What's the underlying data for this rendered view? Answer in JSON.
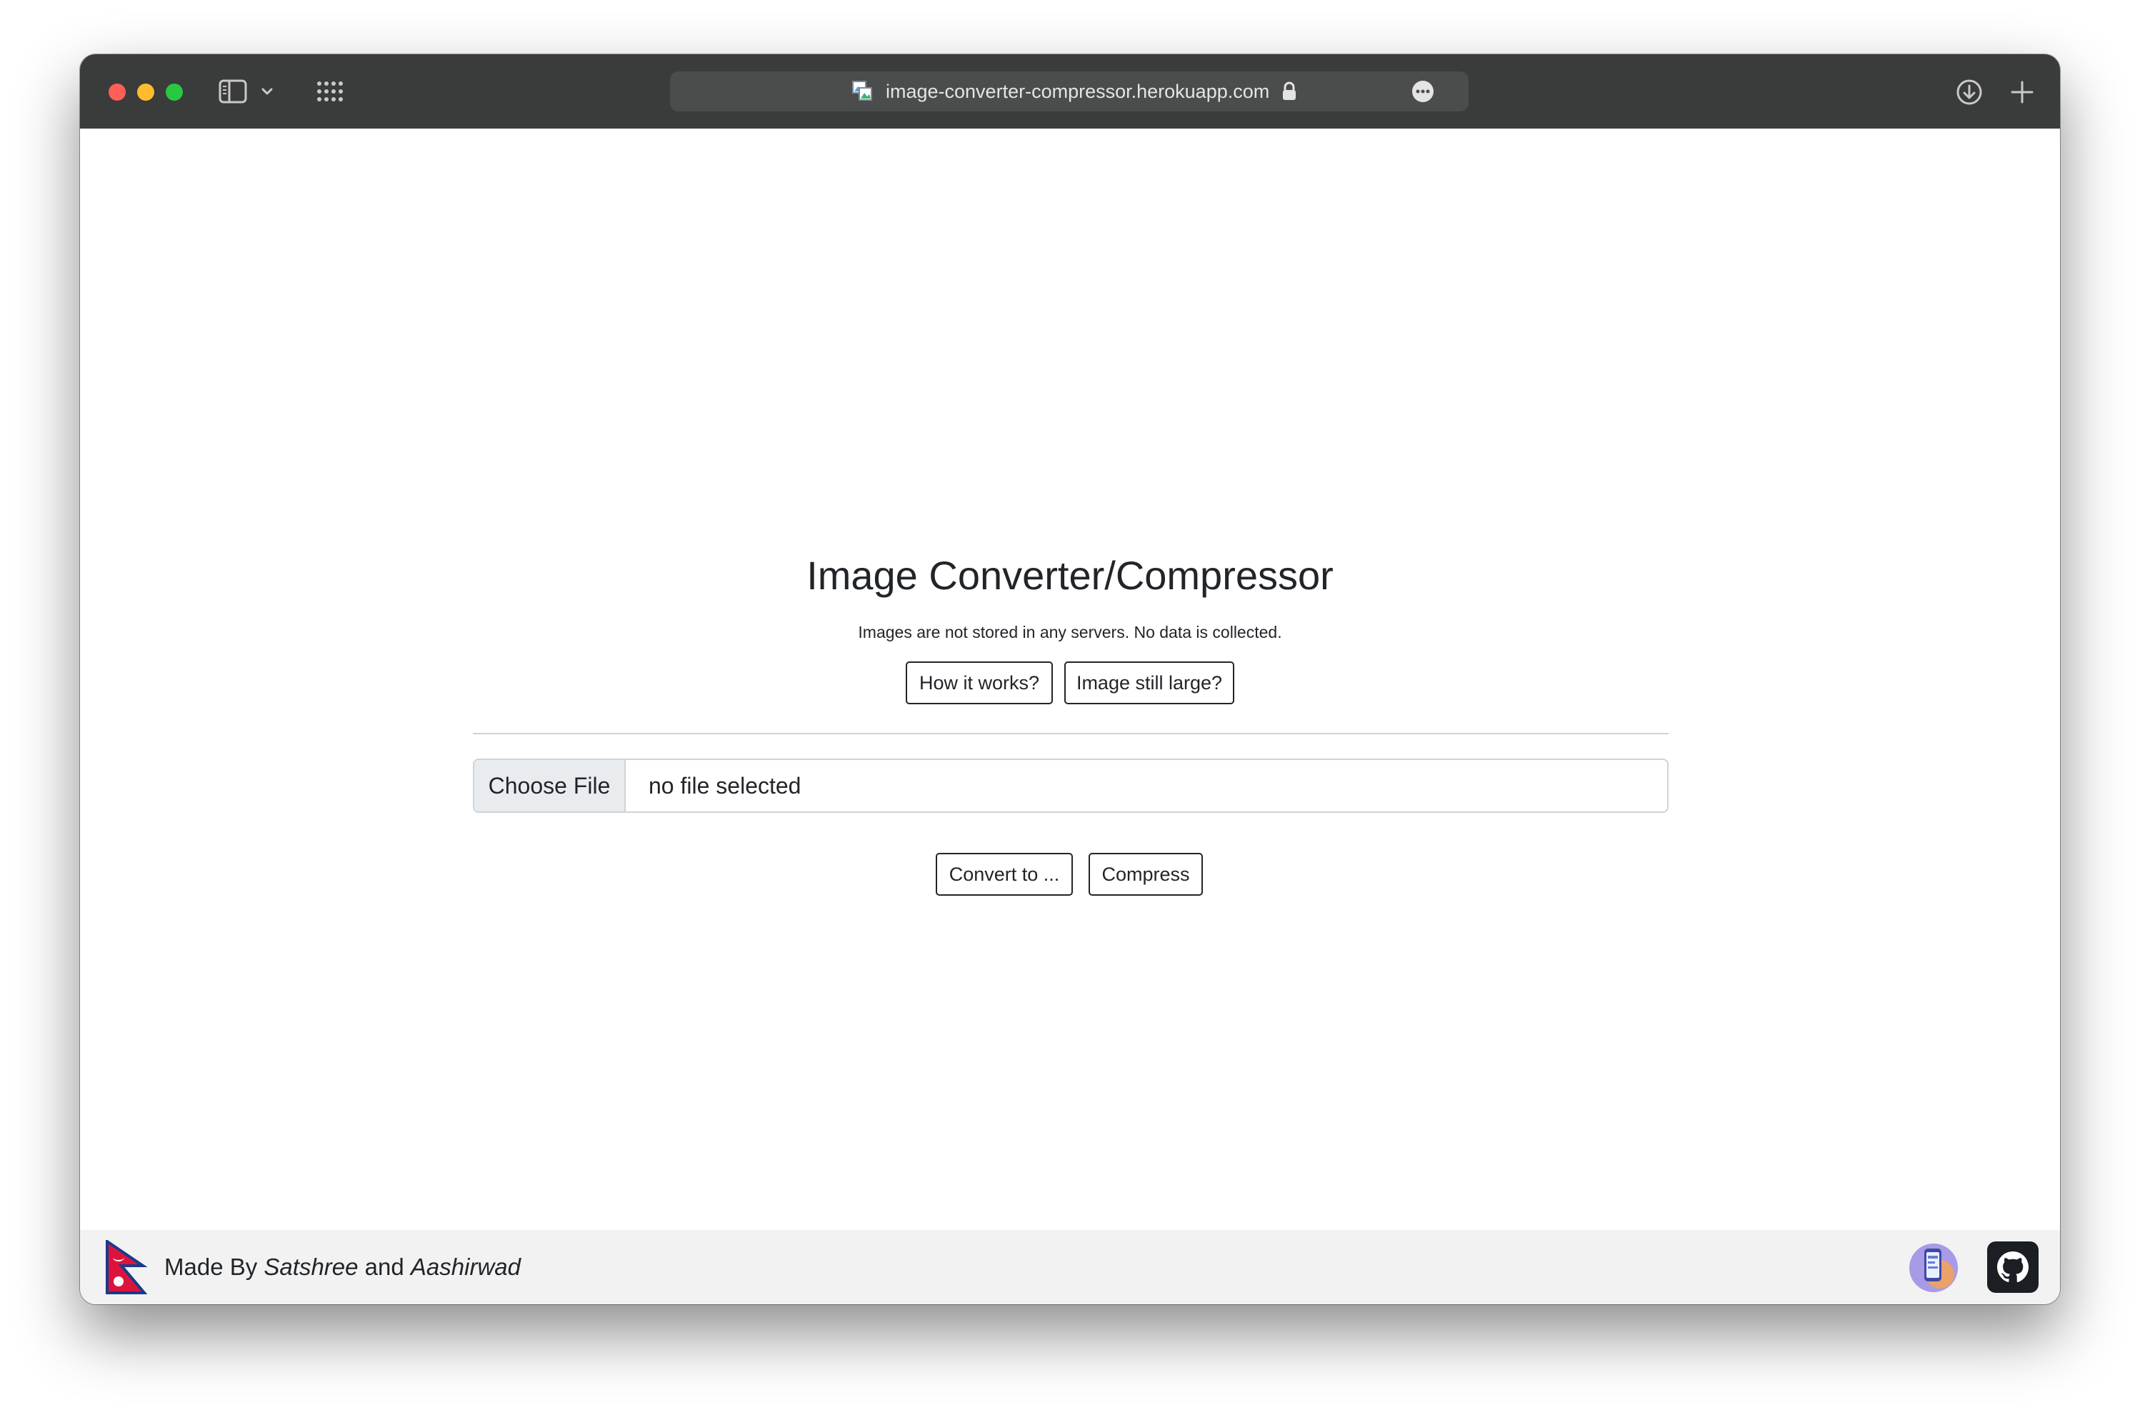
{
  "browser": {
    "url": "image-converter-compressor.herokuapp.com",
    "icons": {
      "sidebar": "sidebar-icon",
      "chevron": "chevron-down-icon",
      "tab_overview": "grid-icon",
      "favicon": "favicon-icon",
      "lock": "lock-icon",
      "more": "more-icon",
      "downloads": "download-icon",
      "new_tab": "plus-icon"
    }
  },
  "page": {
    "title": "Image Converter/Compressor",
    "subtitle": "Images are not stored in any servers. No data is collected.",
    "buttons": {
      "how_it_works": "How it works?",
      "image_still_large": "Image still large?",
      "convert": "Convert to ...",
      "compress": "Compress"
    },
    "file_input": {
      "button_label": "Choose File",
      "status": "no file selected"
    }
  },
  "footer": {
    "prefix": "Made By ",
    "author1": "Satshree",
    "conjunction": " and ",
    "author2": "Aashirwad",
    "icons": {
      "flag": "nepal-flag-icon",
      "app": "app-icon",
      "github": "github-icon"
    }
  },
  "colors": {
    "titlebar": "#3a3b3b",
    "addressbar": "#4b4c4c",
    "text": "#212529",
    "footer_bg": "#f2f2f2",
    "file_button_bg": "#e9ecef"
  }
}
